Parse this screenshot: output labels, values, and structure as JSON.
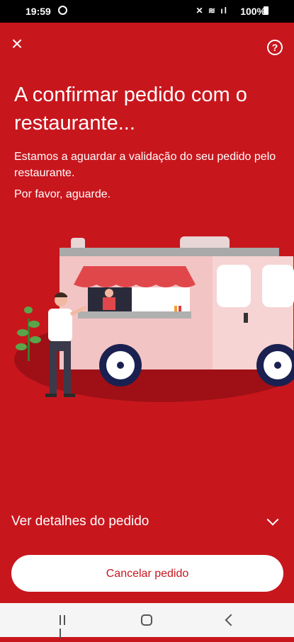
{
  "status_bar": {
    "time": "19:59",
    "battery": "100%"
  },
  "header": {
    "title": "A confirmar pedido com o restaurante...",
    "description": "Estamos a aguardar a validação do seu pedido pelo restaurante.",
    "wait_text": "Por favor, aguarde."
  },
  "details": {
    "label": "Ver detalhes do pedido"
  },
  "actions": {
    "cancel_label": "Cancelar pedido"
  },
  "colors": {
    "brand_red": "#c8161d",
    "white": "#ffffff"
  },
  "icons": {
    "close": "close-icon",
    "help": "help-icon",
    "chevron": "chevron-down-icon"
  }
}
